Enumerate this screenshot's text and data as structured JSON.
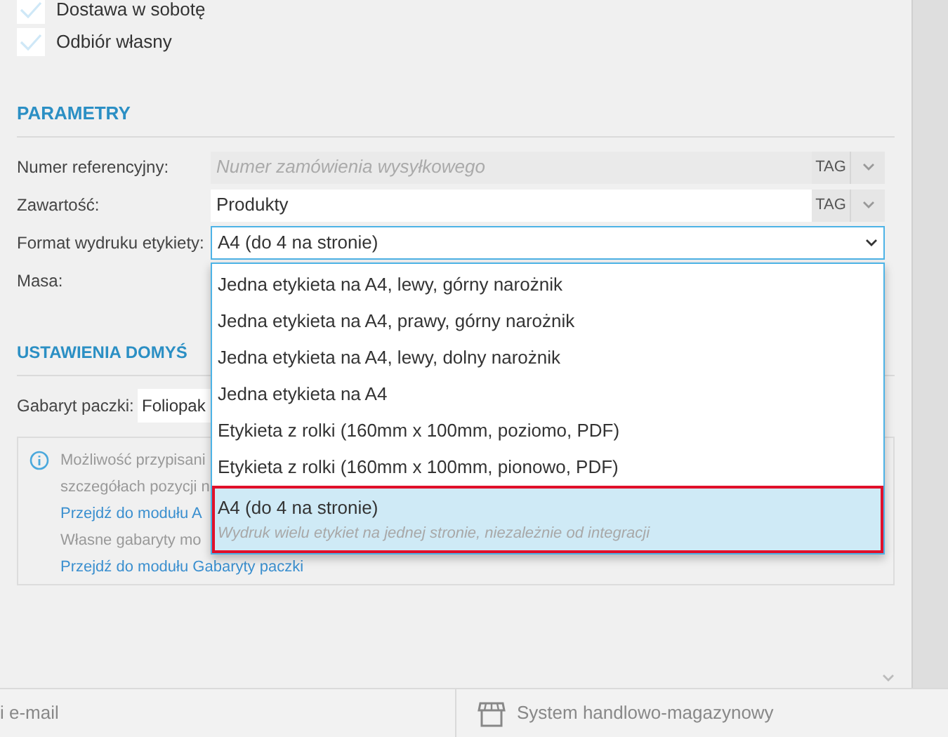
{
  "checkboxes": [
    {
      "label": "Dostawa w sobotę",
      "checked": false
    },
    {
      "label": "Odbiór własny",
      "checked": false
    }
  ],
  "parameters": {
    "title": "PARAMETRY",
    "fields": [
      {
        "kind": "tagged",
        "label": "Numer referencyjny:",
        "placeholder": "Numer zamówienia wysyłkowego",
        "tag": "TAG",
        "disabled": true
      },
      {
        "kind": "tagged",
        "label": "Zawartość:",
        "value": "Produkty",
        "tag": "TAG",
        "disabled": false
      },
      {
        "kind": "select",
        "label": "Format wydruku etykiety:",
        "value": "A4 (do 4 na stronie)",
        "expanded": true
      },
      {
        "kind": "covered",
        "label": "Masa:"
      }
    ]
  },
  "dropdown": {
    "options": [
      {
        "label": "Jedna etykieta na A4, lewy, górny narożnik",
        "selected": false
      },
      {
        "label": "Jedna etykieta na A4, prawy, górny narożnik",
        "selected": false
      },
      {
        "label": "Jedna etykieta na A4, lewy, dolny narożnik",
        "selected": false
      },
      {
        "label": "Jedna etykieta na A4",
        "selected": false
      },
      {
        "label": "Etykieta z rolki (160mm x 100mm, poziomo, PDF)",
        "selected": false
      },
      {
        "label": "Etykieta z rolki (160mm x 100mm, pionowo, PDF)",
        "selected": false
      },
      {
        "label": "A4 (do 4 na stronie)",
        "description": "Wydruk wielu etykiet na jednej stronie, niezależnie od integracji",
        "selected": true
      }
    ]
  },
  "defaults": {
    "title": "USTAWIENIA DOMYŚ",
    "field_label": "Gabaryt paczki:",
    "field_value": "Foliopak",
    "info_lines": [
      {
        "kind": "text",
        "text": "Możliwość przypisani"
      },
      {
        "kind": "text",
        "text": "szczegółach pozycji n"
      },
      {
        "kind": "link",
        "text": "Przejdź do modułu A"
      },
      {
        "kind": "text",
        "text": "Własne gabaryty mo"
      },
      {
        "kind": "link",
        "text": "Przejdź do modułu Gabaryty paczki"
      }
    ]
  },
  "bottom_bar": [
    {
      "kind": "text",
      "label": "i e-mail"
    },
    {
      "kind": "store",
      "label": "System handlowo-magazynowy"
    }
  ]
}
